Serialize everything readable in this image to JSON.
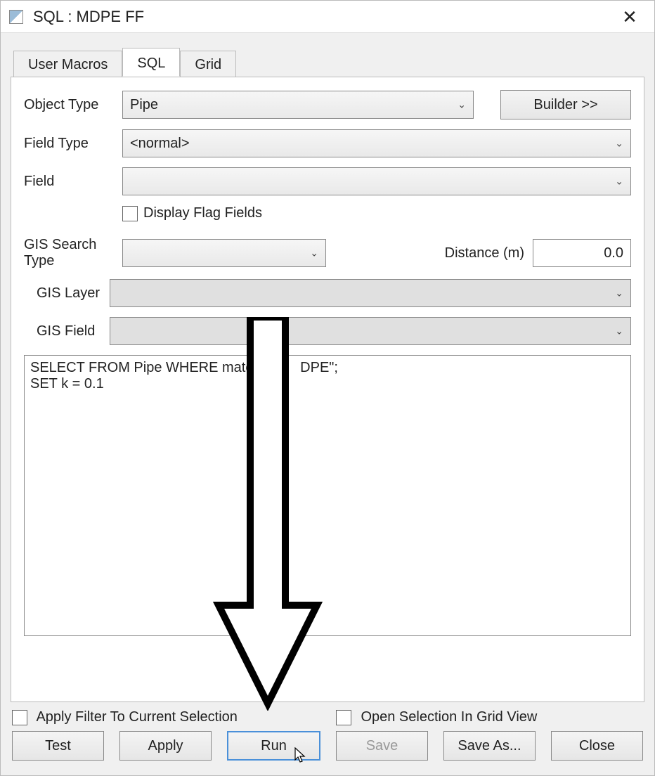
{
  "title": "SQL : MDPE FF",
  "tabs": {
    "user_macros": "User Macros",
    "sql": "SQL",
    "grid": "Grid"
  },
  "labels": {
    "object_type": "Object Type",
    "field_type": "Field Type",
    "field": "Field",
    "display_flag": "Display Flag Fields",
    "gis_search_type": "GIS Search Type",
    "distance": "Distance (m)",
    "gis_layer": "GIS Layer",
    "gis_field": "GIS Field",
    "apply_filter": "Apply Filter To Current Selection",
    "open_grid": "Open Selection In Grid View"
  },
  "values": {
    "object_type": "Pipe",
    "field_type": "<normal>",
    "field": "",
    "gis_search_type": "",
    "distance": "0.0",
    "gis_layer": "",
    "gis_field": "",
    "sql_text": "SELECT FROM Pipe WHERE mate            DPE\";\nSET k = 0.1"
  },
  "buttons": {
    "builder": "Builder >>",
    "test": "Test",
    "apply": "Apply",
    "run": "Run",
    "save": "Save",
    "save_as": "Save As...",
    "close": "Close"
  }
}
